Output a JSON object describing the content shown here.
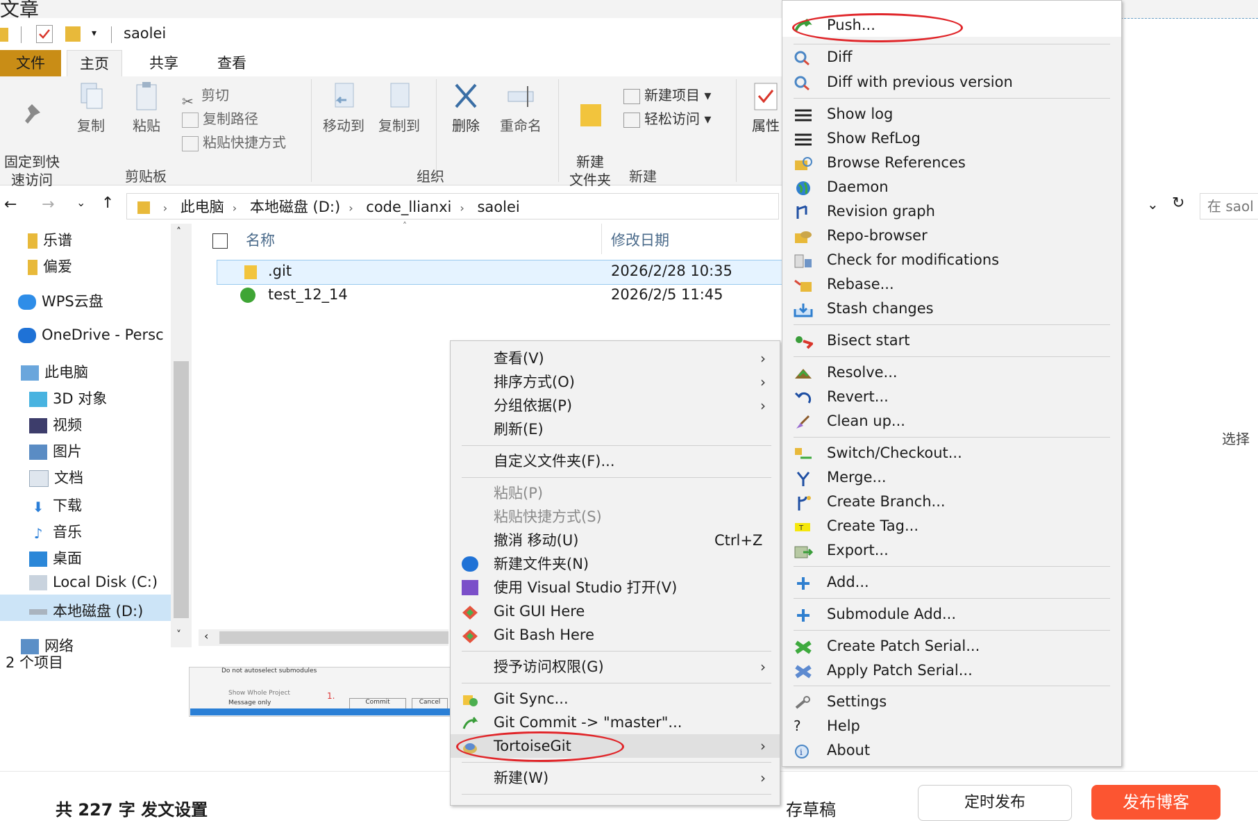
{
  "top": {
    "doc_title_fragment": "文章"
  },
  "window": {
    "title": "saolei"
  },
  "tabs": {
    "file": "文件",
    "home": "主页",
    "share": "共享",
    "view": "查看"
  },
  "ribbon": {
    "pin": "固定到快\n速访问",
    "copy": "复制",
    "paste": "粘贴",
    "cut": "剪切",
    "copy_path": "复制路径",
    "paste_shortcut": "粘贴快捷方式",
    "move_to": "移动到",
    "copy_to": "复制到",
    "delete": "删除",
    "rename": "重命名",
    "new_folder": "新建\n文件夹",
    "new_item": "新建项目",
    "easy_access": "轻松访问",
    "properties": "属性",
    "group_clipboard": "剪贴板",
    "group_organize": "组织",
    "group_new": "新建"
  },
  "address": {
    "crumbs": [
      "此电脑",
      "本地磁盘 (D:)",
      "code_llianxi",
      "saolei"
    ],
    "search_placeholder": "在 saol"
  },
  "nav": {
    "items": [
      "乐谱",
      "偏爱",
      "WPS云盘",
      "OneDrive - Persc",
      "此电脑",
      "3D 对象",
      "视频",
      "图片",
      "文档",
      "下载",
      "音乐",
      "桌面",
      "Local Disk (C:)",
      "本地磁盘 (D:)",
      "网络"
    ],
    "status": "2 个项目"
  },
  "files": {
    "col_name": "名称",
    "col_date": "修改日期",
    "rows": [
      {
        "name": ".git",
        "date": "2026/2/28 10:35"
      },
      {
        "name": "test_12_14",
        "date": "2026/2/5 11:45"
      }
    ]
  },
  "context_menu": {
    "view": "查看(V)",
    "sort": "排序方式(O)",
    "group": "分组依据(P)",
    "refresh": "刷新(E)",
    "customize": "自定义文件夹(F)...",
    "paste": "粘贴(P)",
    "paste_shortcut": "粘贴快捷方式(S)",
    "undo": "撤消 移动(U)",
    "undo_shortcut": "Ctrl+Z",
    "new_folder": "新建文件夹(N)",
    "open_vs": "使用 Visual Studio 打开(V)",
    "git_gui": "Git GUI Here",
    "git_bash": "Git Bash Here",
    "grant_access": "授予访问权限(G)",
    "git_sync": "Git Sync...",
    "git_commit": "Git Commit -> \"master\"...",
    "tortoisegit": "TortoiseGit",
    "new": "新建(W)"
  },
  "submenu": {
    "push": "Push...",
    "diff": "Diff",
    "diff_prev": "Diff with previous version",
    "show_log": "Show log",
    "show_reflog": "Show RefLog",
    "browse_refs": "Browse References",
    "daemon": "Daemon",
    "revision_graph": "Revision graph",
    "repo_browser": "Repo-browser",
    "check_mods": "Check for modifications",
    "rebase": "Rebase...",
    "stash": "Stash changes",
    "bisect": "Bisect start",
    "resolve": "Resolve...",
    "revert": "Revert...",
    "cleanup": "Clean up...",
    "switch": "Switch/Checkout...",
    "merge": "Merge...",
    "create_branch": "Create Branch...",
    "create_tag": "Create Tag...",
    "export": "Export...",
    "add": "Add...",
    "submodule_add": "Submodule Add...",
    "create_patch": "Create Patch Serial...",
    "apply_patch": "Apply Patch Serial...",
    "settings": "Settings",
    "help": "Help",
    "about": "About"
  },
  "background": {
    "dialog_line1": "Do not autoselect submodules",
    "dialog_line2": "Show Whole Project",
    "dialog_line3": "Message only",
    "dialog_commit": "Commit",
    "dialog_cancel": "Cancel",
    "dialog_marker": "1.",
    "bottom_text": "共 227 字  发文设置",
    "draft": "存草稿",
    "timed": "定时发布",
    "publish": "发布博客",
    "side_select": "选择"
  },
  "colors": {
    "file_tab": "#c98d16",
    "selection": "#e5f3ff",
    "annotation_red": "#e0262a",
    "publish_orange": "#fc5531"
  }
}
